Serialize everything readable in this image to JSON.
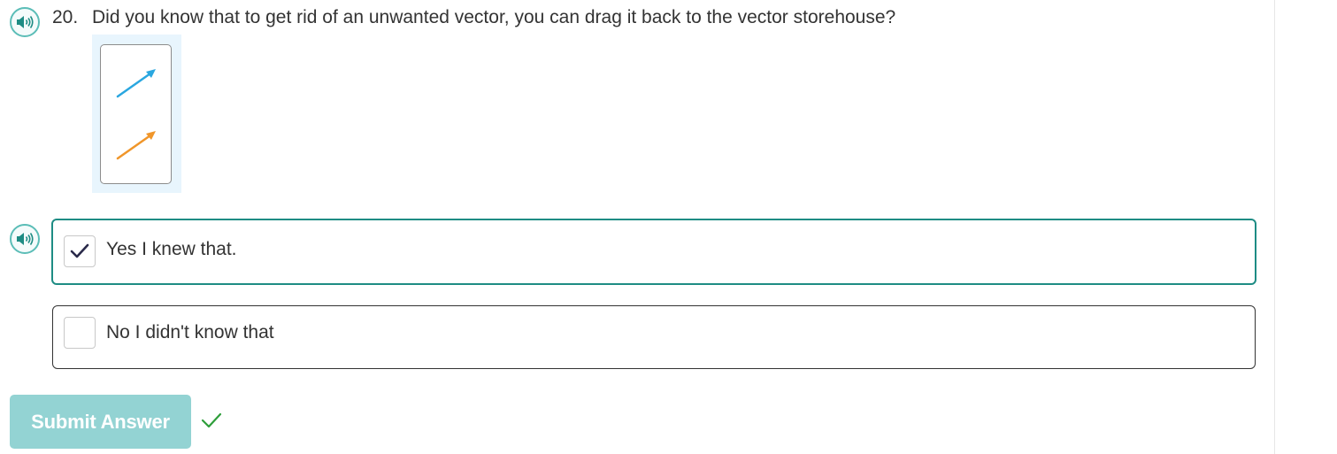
{
  "question": {
    "number": "20.",
    "text": "Did you know that to get rid of an unwanted vector, you can drag it back to the vector storehouse?",
    "figure": {
      "vectors": [
        {
          "name": "blue-vector",
          "color": "#2aa7e0"
        },
        {
          "name": "orange-vector",
          "color": "#f0962a"
        }
      ]
    }
  },
  "options": [
    {
      "label": "Yes I knew that.",
      "checked": true
    },
    {
      "label": "No I didn't know that",
      "checked": false
    }
  ],
  "submit": {
    "label": "Submit Answer",
    "status": "correct"
  },
  "colors": {
    "accent": "#1e8c84",
    "audio": "#5bbdb7",
    "submit_bg": "#93d3d3",
    "check_mark": "#2a2a4a",
    "status_check": "#2e9e3a"
  },
  "icons": {
    "audio": "speaker-icon",
    "checkbox_checked": "checkmark-icon",
    "status": "check-icon"
  }
}
